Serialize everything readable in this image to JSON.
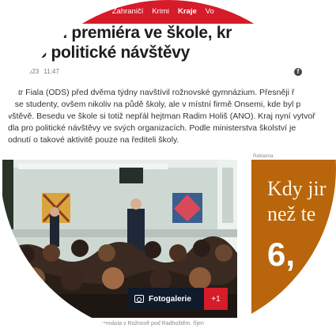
{
  "nav": {
    "items": [
      "Domácí",
      "Zahraničí",
      "Krimi",
      "Kraje",
      "Vo"
    ],
    "active_index": 3
  },
  "article": {
    "headline_line1": "echtěl premiéra ve škole, kr",
    "headline_line2": "pro politické návštěvy",
    "date": "023",
    "time": "11:47",
    "lead_lines": [
      "Petr Fiala (ODS) před dvěma týdny navštívil rožnovské gymnázium. Přesněji ř",
      "e se studenty, ovšem nikoliv na půdě školy, ale v místní firmě Onsemi, kde byl p",
      "vštěvě. Besedu ve škole si totiž nepřál hejtman Radim Holiš (ANO). Kraj nyní vytvoř",
      "dla pro politické návštěvy ve svých organizacích. Podle ministerstva školství je",
      "odnutí o takové aktivitě pouze na řediteli školy."
    ]
  },
  "photo": {
    "gallery_label": "Fotogalerie",
    "gallery_count": "+1",
    "caption": "ymnázia v Rožnově pod Radhoštěm. říjen"
  },
  "ad": {
    "label": "Reklama",
    "line1": "Kdy jir",
    "line2": "než te",
    "big": "6,"
  },
  "icons": {
    "share": "facebook-icon",
    "gallery": "camera-icon"
  },
  "colors": {
    "nav_red": "#d61b29",
    "ad_orange": "#b8650c",
    "gallery_dark": "#0f1a2b"
  }
}
